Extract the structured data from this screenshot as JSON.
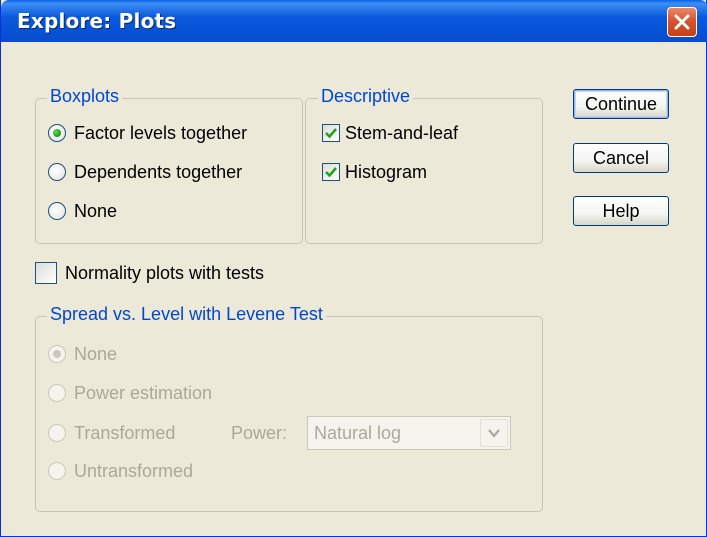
{
  "window": {
    "title": "Explore: Plots"
  },
  "boxplots": {
    "legend": "Boxplots",
    "options": [
      {
        "label": "Factor levels together",
        "checked": true
      },
      {
        "label": "Dependents together",
        "checked": false
      },
      {
        "label": "None",
        "checked": false
      }
    ]
  },
  "descriptive": {
    "legend": "Descriptive",
    "options": [
      {
        "label": "Stem-and-leaf",
        "checked": true
      },
      {
        "label": "Histogram",
        "checked": true
      }
    ]
  },
  "normality": {
    "label": "Normality plots with tests",
    "checked": false
  },
  "spread": {
    "legend": "Spread vs. Level with Levene Test",
    "options": [
      {
        "label": "None",
        "checked": true
      },
      {
        "label": "Power estimation",
        "checked": false
      },
      {
        "label": "Transformed",
        "checked": false
      },
      {
        "label": "Untransformed",
        "checked": false
      }
    ],
    "power_label": "Power:",
    "power_value": "Natural log"
  },
  "buttons": {
    "continue": "Continue",
    "cancel": "Cancel",
    "help": "Help"
  },
  "colors": {
    "titlebar": "#0553d6",
    "legend_text": "#0046d5",
    "disabled_text": "#aca899",
    "face": "#ece9d8"
  }
}
